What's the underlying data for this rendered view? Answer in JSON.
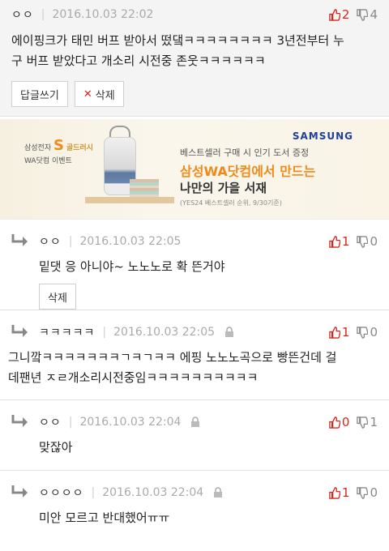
{
  "top_comment": {
    "nick": "ㅇㅇ",
    "date": "2016.10.03 22:02",
    "up": "2",
    "down": "4",
    "text_line1": "에이핑크가 태민 버프 받아서 떴댘ㅋㅋㅋㅋㅋㅋㅋㅋ 3년전부터 누",
    "text_line2": "구 버프 받았다고 개소리 시전중 존웃ㅋㅋㅋㅋㅋㅋ",
    "reply_button": "답글쓰기",
    "delete_button": "삭제"
  },
  "ad": {
    "brand_line1": "삼성전자",
    "brand_line1b": "골드러시",
    "brand_line2": "WA닷컴 이벤트",
    "brand_s": "S",
    "samsung": "SAMSUNG",
    "line1": "베스트셀러 구매 시 인기 도서 증정",
    "line2": "삼성WA닷컴에서 만드는",
    "line3": "나만의 가을 서재",
    "line4": "(YES24 베스트셀러 순위, 9/30기준)"
  },
  "replies": [
    {
      "nick": "ㅇㅇ",
      "date": "2016.10.03 22:05",
      "up": "1",
      "down": "0",
      "text": "밑댓 응 아니야~ 노노노로 확 뜬거야",
      "delete_button": "삭제"
    },
    {
      "nick": "ㅋㅋㅋㅋㅋ",
      "date": "2016.10.03 22:05",
      "up": "1",
      "down": "0",
      "text_line1": "그니깤ㅋㅋㅋㅋㅋㅋㅋㄱㅋㄱㅋㅋ 에핑 노노노곡으로 빵뜬건데 걸",
      "text_line2": "데팬년 ㅈㄹ개소리시전중임ㅋㅋㅋㅋㅋㅋㅋㅋㅋㅋ"
    },
    {
      "nick": "ㅇㅇ",
      "date": "2016.10.03 22:04",
      "up": "0",
      "down": "1",
      "text": "맞잖아"
    },
    {
      "nick": "ㅇㅇㅇㅇ",
      "date": "2016.10.03 22:04",
      "up": "1",
      "down": "0",
      "text": "미안 모르고 반대했어ㅠㅠ"
    }
  ],
  "colors": {
    "vote_up": "#d9261c",
    "vote_down": "#888888",
    "ad_orange": "#f08a1c",
    "samsung_blue": "#1f3f99"
  },
  "icons": {
    "reply_arrow": "reply-arrow-icon",
    "thumb_up": "thumbs-up-icon",
    "thumb_down": "thumbs-down-icon",
    "lock": "lock-icon",
    "delete_x": "x-icon"
  }
}
